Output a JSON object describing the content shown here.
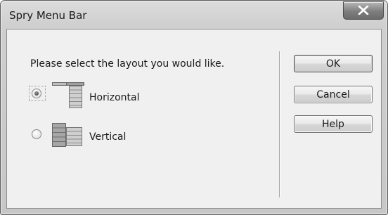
{
  "window": {
    "title": "Spry Menu Bar",
    "close_icon": "close-x-icon"
  },
  "content": {
    "prompt": "Please select the layout you would like.",
    "options": [
      {
        "label": "Horizontal",
        "icon": "horizontal-menu-layout-icon",
        "selected": true
      },
      {
        "label": "Vertical",
        "icon": "vertical-menu-layout-icon",
        "selected": false
      }
    ]
  },
  "buttons": {
    "ok": "OK",
    "cancel": "Cancel",
    "help": "Help"
  }
}
